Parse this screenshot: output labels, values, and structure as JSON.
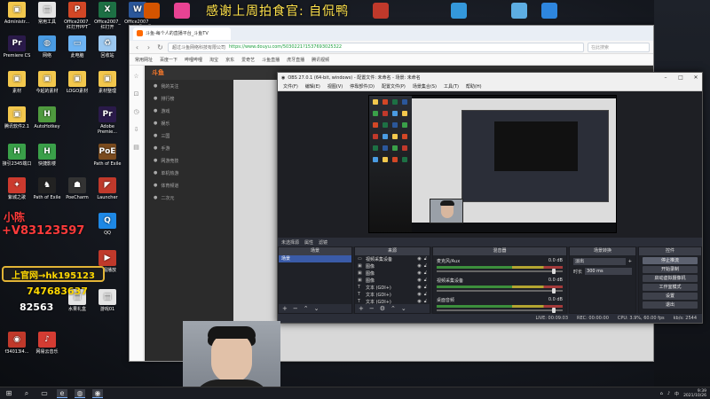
{
  "overlay": {
    "title": "感谢上周拍食官: 自侃鸭",
    "brand_red": "#ff3b3b",
    "gold": "#ffd800"
  },
  "desktop_icons": [
    {
      "label": "Administr...",
      "color": "#f2c74d",
      "glyph": "▣"
    },
    {
      "label": "常用工具",
      "color": "#e5e5e5",
      "glyph": "▤"
    },
    {
      "label": "Office2007_红打开PPT",
      "color": "#d24726",
      "glyph": "P"
    },
    {
      "label": "Office2007_红打开",
      "color": "#1d7044",
      "glyph": "X"
    },
    {
      "label": "Office2007_管理",
      "color": "#2b579a",
      "glyph": "W"
    },
    {
      "label": "Premiere CS",
      "color": "#2a1a4a",
      "glyph": "Pr"
    },
    {
      "label": "网络",
      "color": "#4a9be2",
      "glyph": "◍"
    },
    {
      "label": "此电脑",
      "color": "#6db3f2",
      "glyph": "▭"
    },
    {
      "label": "回收站",
      "color": "#9cc8f0",
      "glyph": "♻"
    },
    {
      "label": "CPU-Z",
      "color": "#3b5b9a",
      "glyph": "Z"
    },
    {
      "label": "素材",
      "color": "#f2c74d",
      "glyph": "▣"
    },
    {
      "label": "今起的素材",
      "color": "#f2c74d",
      "glyph": "▣"
    },
    {
      "label": "LOGO素材",
      "color": "#f2c74d",
      "glyph": "▣"
    },
    {
      "label": "素材整理",
      "color": "#f2c74d",
      "glyph": "▣"
    },
    {
      "label": "腾讯软件2.1",
      "color": "#f2c74d",
      "glyph": "▣"
    },
    {
      "label": "AutoHotkey",
      "color": "#4f9a3e",
      "glyph": "H"
    },
    {
      "label": "Adobe Premie...",
      "color": "#2a1a4a",
      "glyph": "Pr"
    },
    {
      "label": "Path of Exile",
      "color": "#7a4b1e",
      "glyph": "PoE"
    },
    {
      "label": "接引2345端口",
      "color": "#3aa049",
      "glyph": "H"
    },
    {
      "label": "快捷影楼",
      "color": "#3aa049",
      "glyph": "H"
    },
    {
      "label": "紫城之歌",
      "color": "#cc3a2e",
      "glyph": "✦"
    },
    {
      "label": "Path of Exile",
      "color": "#222",
      "glyph": "♞"
    },
    {
      "label": "PoeCharm",
      "color": "#333",
      "glyph": "☗"
    },
    {
      "label": "Launcher",
      "color": "#c0392b",
      "glyph": "◤"
    },
    {
      "label": "QQ",
      "color": "#1e88e5",
      "glyph": "Q"
    },
    {
      "label": "发掘播放",
      "color": "#c0392b",
      "glyph": "▶"
    },
    {
      "label": "水果礼盒",
      "color": "#e5e5e5",
      "glyph": "▤"
    },
    {
      "label": "游戏01",
      "color": "#e5e5e5",
      "glyph": "▤"
    },
    {
      "label": "f34013l4...",
      "color": "#c0392b",
      "glyph": "◉"
    },
    {
      "label": "网易云音乐",
      "color": "#d43c33",
      "glyph": "♪"
    }
  ],
  "stream_overlay": {
    "vx_text": "+V83123597",
    "promo_text": "上官网→hk195123",
    "qq_text": "747683637",
    "mid_text": "82563",
    "side_text": "小陈"
  },
  "browser": {
    "tab_title": "斗鱼-每个人的直播平台_斗鱼TV",
    "url": "https://www.douyu.com/5030221?1537693025322",
    "secure_label": "超过斗鱼网络科技有限公司",
    "search_placeholder": "在此搜索",
    "bookmarks": [
      "常用网址",
      "百度一下",
      "哔哩哔哩",
      "淘宝",
      "京东",
      "爱奇艺",
      "斗鱼直播",
      "虎牙直播",
      "腾讯视频"
    ],
    "site_logo": "斗鱼",
    "left_menu": [
      "我的关注",
      "排行榜",
      "游戏",
      "娱乐",
      "三国",
      "手游",
      "网游竞技",
      "单机热游",
      "体育频道",
      "二次元"
    ]
  },
  "obs": {
    "title": "OBS 27.0.1 (64-bit, windows) - 配置文件: 未命名 - 场景: 未命名",
    "menu": [
      "文件(F)",
      "编辑(E)",
      "视图(V)",
      "停靠部件(D)",
      "配置文件(P)",
      "场景集合(S)",
      "工具(T)",
      "帮助(H)"
    ],
    "preview_status": "未选择源",
    "preview_buttons": [
      "属性",
      "滤镜"
    ],
    "docks": {
      "scenes_label": "场景",
      "sources_label": "来源",
      "mixer_label": "混音器",
      "transitions_label": "场景转换",
      "controls_label": "控件"
    },
    "scenes": [
      "场景"
    ],
    "sources": [
      "视频采集设备",
      "图像",
      "图像",
      "图像",
      "文本 (GDI+)",
      "文本 (GDI+)",
      "文本 (GDI+)"
    ],
    "mixer": [
      {
        "name": "麦克风/Aux",
        "db": "0.0 dB"
      },
      {
        "name": "视频采集设备",
        "db": "0.0 dB"
      },
      {
        "name": "桌面音频",
        "db": "0.0 dB"
      }
    ],
    "transition": {
      "type": "淡出",
      "duration_label": "时长",
      "duration": "300 ms"
    },
    "controls": [
      "停止推流",
      "开始录制",
      "启动虚拟摄像机",
      "工作室模式",
      "设置",
      "退出"
    ],
    "status": {
      "live": "LIVE: 00:09:03",
      "rec": "REC: 00:00:00",
      "cpu": "CPU: 3.9%, 60.00 fps",
      "kbps": "kb/s: 2544"
    }
  },
  "taskbar": {
    "items": [
      "⊞",
      "⌕",
      "▭",
      "e",
      "◍",
      "◉"
    ],
    "time": "9:39",
    "date": "2021/10/26"
  }
}
